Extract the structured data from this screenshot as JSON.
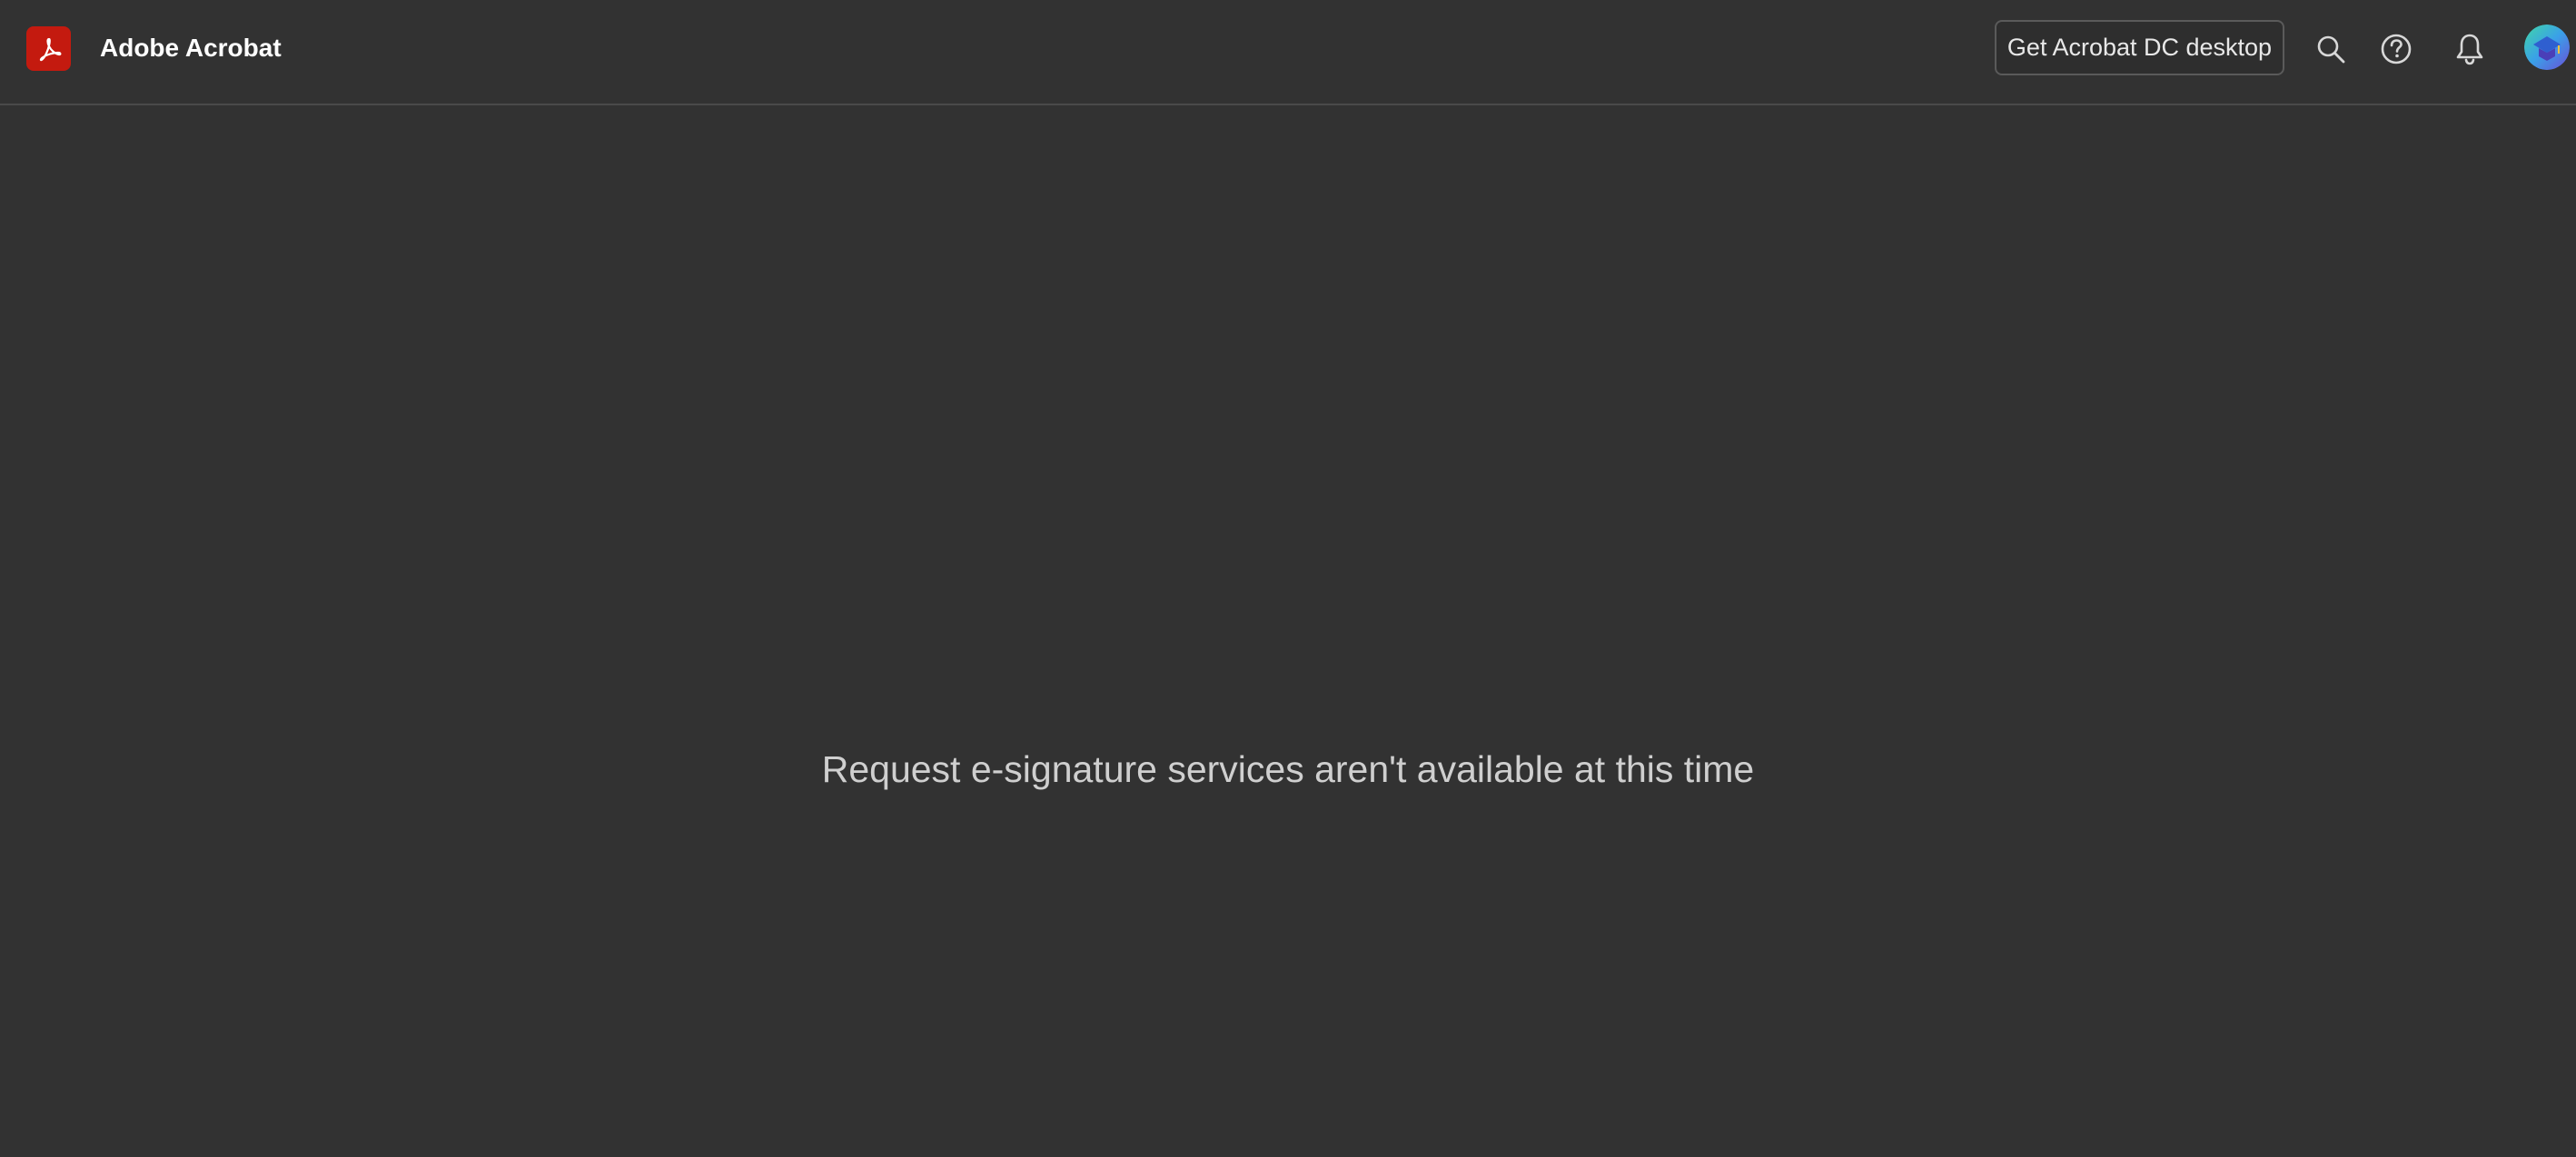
{
  "header": {
    "app_title": "Adobe Acrobat",
    "get_desktop_label": "Get Acrobat DC desktop",
    "icons": [
      "acrobat-logo-icon",
      "search-icon",
      "help-icon",
      "bell-icon",
      "avatar"
    ]
  },
  "main": {
    "message": "Request e-signature services aren't available at this time"
  },
  "colors": {
    "background": "#323232",
    "brand_red": "#c41a0f",
    "text_primary": "#ffffff",
    "text_secondary": "#cfcfcf"
  }
}
